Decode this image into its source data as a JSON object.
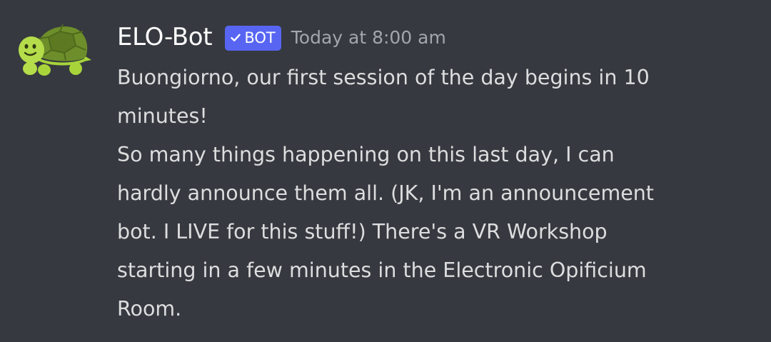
{
  "message": {
    "author": "ELO-Bot",
    "tag": "BOT",
    "timestamp": "Today at 8:00 am",
    "avatar_icon": "turtle-icon",
    "lines": [
      "Buongiorno, our first session of the day begins in 10",
      "minutes!",
      "So many things happening on this last day, I can",
      "hardly announce them all. (JK, I'm an announcement",
      "bot. I LIVE for this stuff!) There's a VR Workshop",
      "starting in a few minutes in the Electronic Opificium",
      "Room."
    ]
  },
  "colors": {
    "background": "#36393f",
    "username": "#ffffff",
    "tag_background": "#5865f2",
    "timestamp": "#a3a6aa",
    "text": "#dcddde"
  }
}
